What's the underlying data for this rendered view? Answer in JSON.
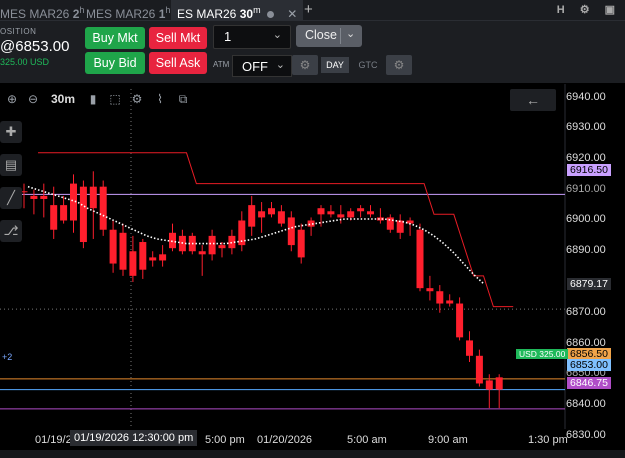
{
  "tabs": [
    {
      "symbol": "MES MAR26",
      "resolution": "2",
      "unit": "h",
      "active": false
    },
    {
      "symbol": "MES MAR26",
      "resolution": "1",
      "unit": "h",
      "active": false
    },
    {
      "symbol": "ES MAR26",
      "resolution": "30",
      "unit": "m",
      "active": true
    }
  ],
  "tab_close_glyph": "✕",
  "new_tab_glyph": "+",
  "window_icons": [
    "H",
    "gear",
    "lock"
  ],
  "window_icon_text": "H ⚙ ▣",
  "position": {
    "label": "OSITION",
    "avg_price": "@6853.00",
    "pnl": "325.00 USD"
  },
  "buttons": {
    "buy_mkt": "Buy Mkt",
    "sell_mkt": "Sell Mkt",
    "buy_bid": "Buy Bid",
    "sell_ask": "Sell Ask",
    "close": "Close"
  },
  "quantity": {
    "value": "1"
  },
  "atm": {
    "label": "ATM",
    "value": "OFF"
  },
  "tif": {
    "day": "DAY",
    "gtc": "GTC"
  },
  "toolbar": {
    "resolution": "30m"
  },
  "back_glyph": "←",
  "colors": {
    "bearish": "#ff1f2d",
    "bullish": "#ff1f2d",
    "channel": "#e81c25",
    "moving_average": "#ffffff",
    "position_line": "#1fb95a",
    "ask_line": "#e68a2e",
    "bid_line": "#56aaff",
    "stop_line": "#b04dc8",
    "level_line": "#c9a0ff"
  },
  "time_axis": {
    "labels": [
      "01/19/2",
      "5:00 pm",
      "01/20/2026",
      "5:00 am",
      "9:00 am",
      "1:30 pm"
    ],
    "crosshair_time": "01/19/2026 12:30:00 pm"
  },
  "price_axis": {
    "ticks": [
      "6940.00",
      "6930.00",
      "6920.00",
      "6910.00",
      "6900.00",
      "6890.00",
      "6870.00",
      "6860.00",
      "6850.00",
      "6840.00",
      "6830.00"
    ]
  },
  "price_badges": {
    "level": "6916.50",
    "crosshair": "6879.17",
    "position_price": "6856.50",
    "current": "6853.00",
    "stop": "6846.75",
    "position_pnl": "USD 325.00"
  },
  "left_marker": "+2",
  "chart_data": {
    "type": "candlestick",
    "y_range": [
      6830,
      6945
    ],
    "candles": [
      {
        "o": 6917.5,
        "h": 6920.0,
        "l": 6912.0,
        "c": 6917.5
      },
      {
        "o": 6916.0,
        "h": 6918.0,
        "l": 6910.0,
        "c": 6915.0
      },
      {
        "o": 6915.0,
        "h": 6920.0,
        "l": 6909.0,
        "c": 6916.0
      },
      {
        "o": 6913.0,
        "h": 6919.0,
        "l": 6902.0,
        "c": 6905.0
      },
      {
        "o": 6913.0,
        "h": 6916.0,
        "l": 6907.0,
        "c": 6908.0
      },
      {
        "o": 6920.0,
        "h": 6923.0,
        "l": 6904.0,
        "c": 6908.0
      },
      {
        "o": 6919.0,
        "h": 6921.0,
        "l": 6899.0,
        "c": 6901.0
      },
      {
        "o": 6912.0,
        "h": 6924.0,
        "l": 6902.0,
        "c": 6919.0
      },
      {
        "o": 6919.0,
        "h": 6921.0,
        "l": 6903.0,
        "c": 6905.0
      },
      {
        "o": 6905.0,
        "h": 6908.0,
        "l": 6891.0,
        "c": 6894.0
      },
      {
        "o": 6904.0,
        "h": 6907.0,
        "l": 6890.0,
        "c": 6892.0
      },
      {
        "o": 6898.0,
        "h": 6903.0,
        "l": 6888.0,
        "c": 6890.0
      },
      {
        "o": 6901.0,
        "h": 6902.0,
        "l": 6889.0,
        "c": 6892.0
      },
      {
        "o": 6895.0,
        "h": 6898.0,
        "l": 6893.0,
        "c": 6896.0
      },
      {
        "o": 6897.0,
        "h": 6900.0,
        "l": 6893.0,
        "c": 6895.0
      },
      {
        "o": 6904.0,
        "h": 6907.0,
        "l": 6898.0,
        "c": 6899.0
      },
      {
        "o": 6903.0,
        "h": 6905.0,
        "l": 6897.0,
        "c": 6898.0
      },
      {
        "o": 6903.0,
        "h": 6904.0,
        "l": 6897.0,
        "c": 6898.0
      },
      {
        "o": 6898.0,
        "h": 6900.0,
        "l": 6890.0,
        "c": 6897.0
      },
      {
        "o": 6903.0,
        "h": 6905.0,
        "l": 6895.0,
        "c": 6897.0
      },
      {
        "o": 6899.0,
        "h": 6901.0,
        "l": 6896.0,
        "c": 6900.0
      },
      {
        "o": 6903.0,
        "h": 6905.0,
        "l": 6897.0,
        "c": 6899.0
      },
      {
        "o": 6908.0,
        "h": 6911.0,
        "l": 6898.0,
        "c": 6900.0
      },
      {
        "o": 6913.0,
        "h": 6916.0,
        "l": 6903.0,
        "c": 6906.0
      },
      {
        "o": 6909.0,
        "h": 6914.0,
        "l": 6904.0,
        "c": 6911.0
      },
      {
        "o": 6912.0,
        "h": 6914.0,
        "l": 6909.0,
        "c": 6910.0
      },
      {
        "o": 6911.0,
        "h": 6913.0,
        "l": 6906.0,
        "c": 6907.0
      },
      {
        "o": 6909.0,
        "h": 6911.0,
        "l": 6898.0,
        "c": 6900.0
      },
      {
        "o": 6905.0,
        "h": 6907.0,
        "l": 6894.0,
        "c": 6896.0
      },
      {
        "o": 6906.0,
        "h": 6909.0,
        "l": 6903.0,
        "c": 6908.0
      },
      {
        "o": 6910.0,
        "h": 6913.0,
        "l": 6906.0,
        "c": 6912.0
      },
      {
        "o": 6911.0,
        "h": 6913.0,
        "l": 6909.0,
        "c": 6910.0
      },
      {
        "o": 6910.0,
        "h": 6913.0,
        "l": 6907.0,
        "c": 6909.0
      },
      {
        "o": 6911.0,
        "h": 6912.0,
        "l": 6908.0,
        "c": 6909.0
      },
      {
        "o": 6911.0,
        "h": 6913.0,
        "l": 6909.0,
        "c": 6912.0
      },
      {
        "o": 6911.0,
        "h": 6913.0,
        "l": 6909.0,
        "c": 6910.0
      },
      {
        "o": 6909.0,
        "h": 6912.0,
        "l": 6907.0,
        "c": 6908.0
      },
      {
        "o": 6909.0,
        "h": 6910.0,
        "l": 6904.0,
        "c": 6905.0
      },
      {
        "o": 6908.0,
        "h": 6910.0,
        "l": 6902.0,
        "c": 6904.0
      },
      {
        "o": 6907.0,
        "h": 6909.0,
        "l": 6903.0,
        "c": 6908.0
      },
      {
        "o": 6905.0,
        "h": 6907.0,
        "l": 6885.0,
        "c": 6886.0
      },
      {
        "o": 6886.0,
        "h": 6890.0,
        "l": 6882.0,
        "c": 6885.0
      },
      {
        "o": 6885.0,
        "h": 6887.0,
        "l": 6878.0,
        "c": 6881.0
      },
      {
        "o": 6882.0,
        "h": 6884.0,
        "l": 6880.0,
        "c": 6881.0
      },
      {
        "o": 6881.0,
        "h": 6883.0,
        "l": 6869.0,
        "c": 6870.0
      },
      {
        "o": 6869.0,
        "h": 6872.0,
        "l": 6862.0,
        "c": 6864.0
      },
      {
        "o": 6864.0,
        "h": 6866.0,
        "l": 6854.0,
        "c": 6855.0
      },
      {
        "o": 6856.0,
        "h": 6858.0,
        "l": 6847.0,
        "c": 6853.0
      },
      {
        "o": 6857.0,
        "h": 6858.0,
        "l": 6847.0,
        "c": 6853.0
      }
    ],
    "channel_upper": [
      6930,
      6930,
      6930,
      6930,
      6930,
      6930,
      6930,
      6930,
      6930,
      6930,
      6930,
      6930,
      6930,
      6930,
      6930,
      6930,
      6920,
      6920,
      6920,
      6920,
      6920,
      6920,
      6920,
      6920,
      6920,
      6920,
      6920,
      6920,
      6920,
      6920,
      6920,
      6920,
      6920,
      6920,
      6920,
      6920,
      6920,
      6920,
      6920,
      6920,
      6910,
      6910,
      6910,
      6900,
      6890,
      6890,
      6880,
      6880,
      6880
    ],
    "moving_average": [
      6919,
      6918,
      6917,
      6916,
      6915,
      6914,
      6912,
      6910.5,
      6909,
      6907.5,
      6906,
      6904.5,
      6903,
      6902,
      6901.5,
      6901,
      6900.5,
      6900.5,
      6900.5,
      6900.5,
      6900.5,
      6901,
      6901.5,
      6902,
      6903,
      6904,
      6905,
      6906,
      6906.5,
      6907,
      6907.5,
      6908,
      6908.5,
      6908.5,
      6908.5,
      6908.5,
      6908.5,
      6908,
      6907.5,
      6906.5,
      6905,
      6903,
      6900.5,
      6897.5,
      6894,
      6890.5,
      6887.5
    ]
  }
}
